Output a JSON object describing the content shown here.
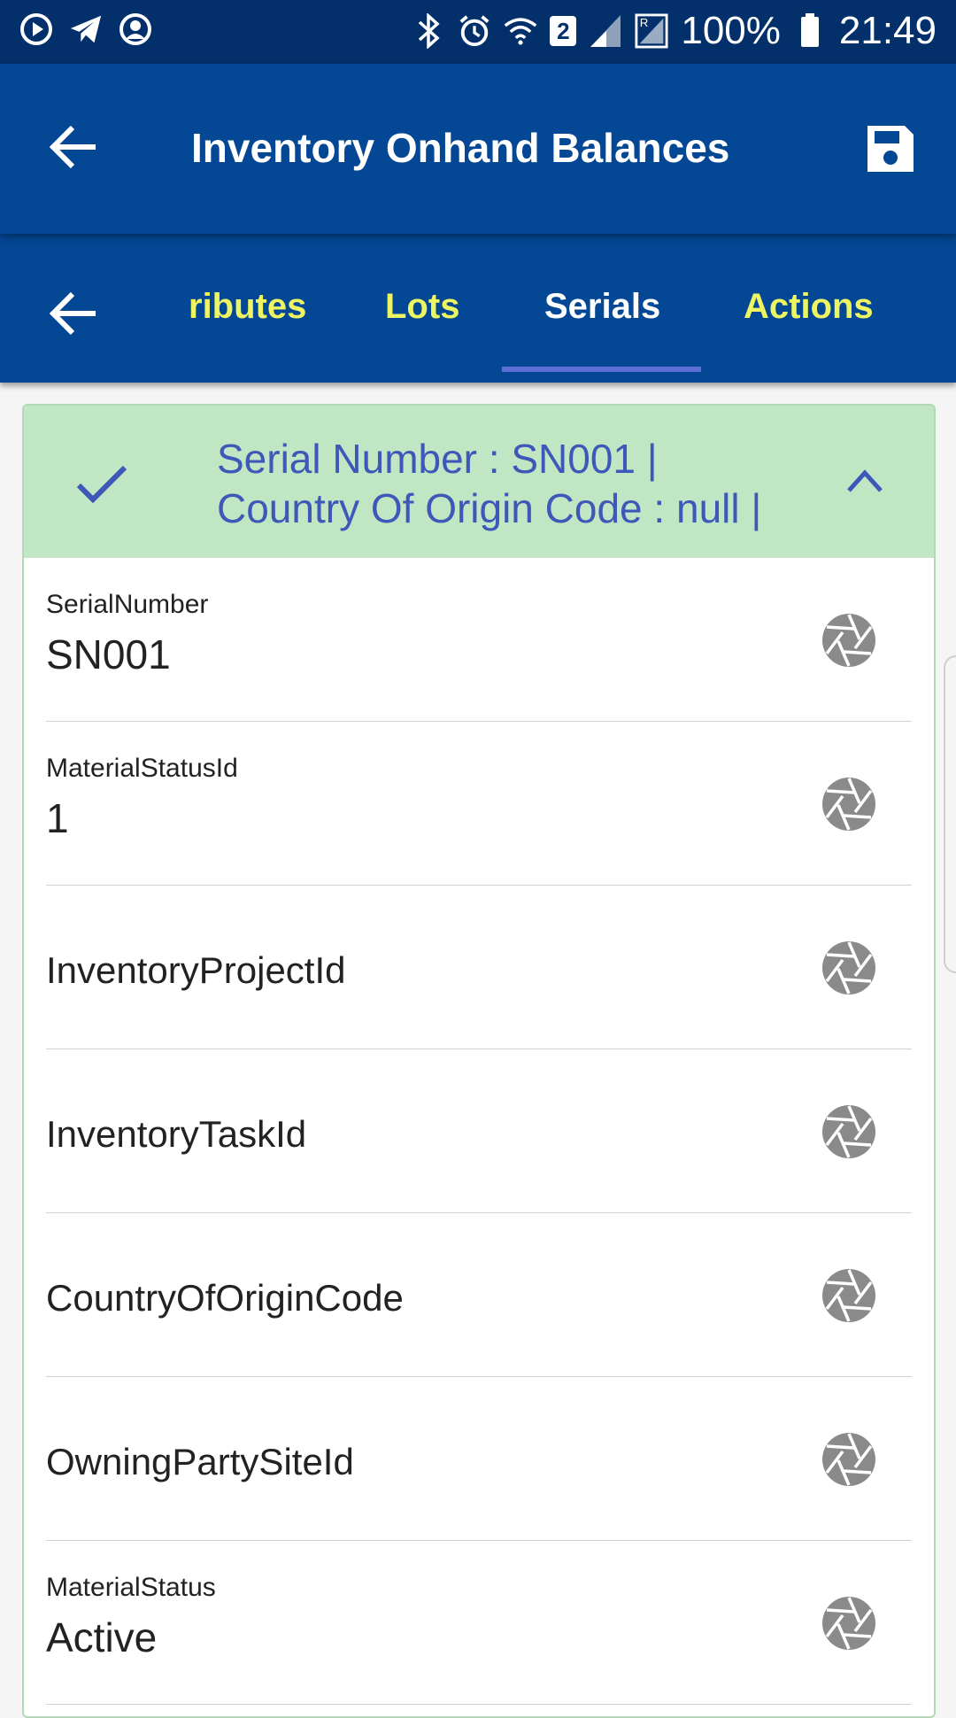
{
  "status_bar": {
    "left_icons": [
      "media-play-icon",
      "telegram-icon",
      "account-icon"
    ],
    "right_icons": [
      "bluetooth-icon",
      "alarm-icon",
      "wifi-icon",
      "sim2-icon",
      "signal-icon",
      "signal-roaming-icon",
      "battery-icon"
    ],
    "sim_badge": "2",
    "battery": "100%",
    "time": "21:49"
  },
  "app_bar": {
    "title": "Inventory Onhand Balances"
  },
  "tabs": [
    {
      "label": "ributes",
      "active": false
    },
    {
      "label": "Lots",
      "active": false
    },
    {
      "label": "Serials",
      "active": true
    },
    {
      "label": "Actions",
      "active": false
    }
  ],
  "card": {
    "header_line1": "Serial Number : SN001 |",
    "header_line2": "Country Of Origin Code : null |",
    "rows": [
      {
        "label": "SerialNumber",
        "value": "SN001"
      },
      {
        "label": "MaterialStatusId",
        "value": "1"
      },
      {
        "label": "InventoryProjectId",
        "value": ""
      },
      {
        "label": "InventoryTaskId",
        "value": ""
      },
      {
        "label": "CountryOfOriginCode",
        "value": ""
      },
      {
        "label": "OwningPartySiteId",
        "value": ""
      },
      {
        "label": "MaterialStatus",
        "value": "Active"
      }
    ]
  },
  "colors": {
    "status_bar": "#03306a",
    "app_bar": "#044794",
    "tab_inactive": "#eef562",
    "tab_active": "#ffffff",
    "tab_indicator": "#5b6fd6",
    "card_header": "#c1e6c3",
    "card_title": "#3d58b8",
    "lens_icon": "#8a8a8a"
  }
}
